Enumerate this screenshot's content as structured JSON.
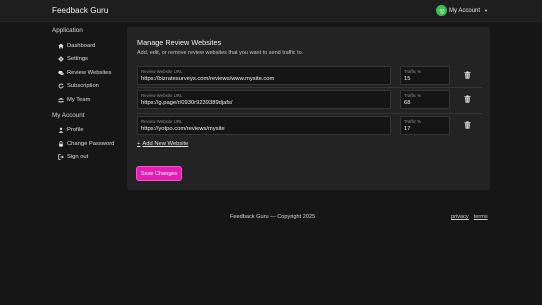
{
  "app": {
    "brand": "Feedback Guru"
  },
  "account": {
    "label": "My Account"
  },
  "sidebar": {
    "application_heading": "Application",
    "application_items": [
      {
        "label": "Dashboard",
        "icon": "home-icon"
      },
      {
        "label": "Settings",
        "icon": "gear-icon"
      },
      {
        "label": "Review Websites",
        "icon": "chat-bubbles-icon"
      },
      {
        "label": "Subscription",
        "icon": "refresh-icon"
      },
      {
        "label": "My Team",
        "icon": "team-icon"
      }
    ],
    "account_heading": "My Account",
    "account_items": [
      {
        "label": "Profile",
        "icon": "user-icon"
      },
      {
        "label": "Change Password",
        "icon": "lock-icon"
      },
      {
        "label": "Sign out",
        "icon": "sign-out-icon"
      }
    ]
  },
  "main": {
    "title": "Manage Review Websites",
    "subtitle": "Add, edit, or remove review websites that you want to send traffic to.",
    "url_label": "Review Website URL",
    "pct_label": "Traffic %",
    "websites": [
      {
        "url": "https://bizratesurveys.com/reviews/www.mysite.com",
        "traffic": "15"
      },
      {
        "url": "https://g.page/r/0930r9239389djafs/",
        "traffic": "68"
      },
      {
        "url": "https://yotpo.com/reviews/mysite",
        "traffic": "17"
      }
    ],
    "add_label": "Add New Website",
    "save_label": "Save Changes"
  },
  "footer": {
    "copyright": "Feedback Guru — Copyright 2025",
    "privacy": "privacy",
    "terms": "terms"
  },
  "colors": {
    "background": "#161616",
    "panel": "#232323",
    "accent": "#e21fb2",
    "avatar": "#37c24f"
  }
}
